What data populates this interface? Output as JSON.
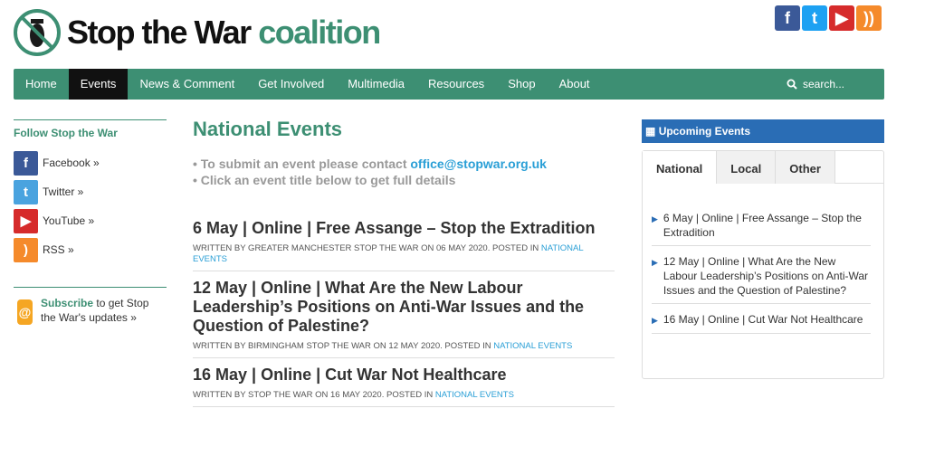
{
  "brand": {
    "name_part1": "Stop the War",
    "name_part2": "coalition"
  },
  "social_top": [
    {
      "icon": "facebook-icon",
      "glyph": "f",
      "color": "#3b5998"
    },
    {
      "icon": "twitter-icon",
      "glyph": "t",
      "color": "#1da1f2"
    },
    {
      "icon": "youtube-icon",
      "glyph": "▶",
      "color": "#d62b2b"
    },
    {
      "icon": "rss-icon",
      "glyph": "))",
      "color": "#f58a2b"
    }
  ],
  "nav": {
    "items": [
      "Home",
      "Events",
      "News & Comment",
      "Get Involved",
      "Multimedia",
      "Resources",
      "Shop",
      "About"
    ],
    "active": "Events",
    "search_placeholder": "search..."
  },
  "follow": {
    "title": "Follow Stop the War",
    "items": [
      {
        "label": "Facebook »",
        "icon": "facebook-icon",
        "color": "#3b5998",
        "glyph": "f"
      },
      {
        "label": "Twitter »",
        "icon": "twitter-icon",
        "color": "#4aa3df",
        "glyph": "t"
      },
      {
        "label": "YouTube »",
        "icon": "youtube-icon",
        "color": "#d62b2b",
        "glyph": "▶"
      },
      {
        "label": "RSS »",
        "icon": "rss-icon",
        "color": "#f58a2b",
        "glyph": ")"
      }
    ],
    "subscribe_bold": "Subscribe",
    "subscribe_rest": " to get Stop the War's updates »"
  },
  "main": {
    "title": "National Events",
    "intro_line1_prefix": "• To submit an event please contact ",
    "intro_email": "office@stopwar.org.uk",
    "intro_line2": "• Click an event title below to get full details",
    "events": [
      {
        "title": "6 May | Online | Free Assange – Stop the Extradition",
        "meta": "Written by Greater Manchester Stop the War on 06 May 2020. Posted in ",
        "category": "National Events"
      },
      {
        "title": "12 May | Online | What Are the New Labour Leadership’s Positions on Anti-War Issues and the Question of Palestine?",
        "meta": "Written by Birmingham Stop the War on 12 May 2020. Posted in ",
        "category": "National Events"
      },
      {
        "title": "16 May | Online | Cut War Not Healthcare",
        "meta": "Written by Stop the War on 16 May 2020. Posted in ",
        "category": "National Events"
      }
    ]
  },
  "sidebar": {
    "upcoming_title": "Upcoming Events",
    "tabs": [
      "National",
      "Local",
      "Other"
    ],
    "active_tab": "National",
    "items": [
      "6 May | Online | Free Assange – Stop the Extradition",
      "12 May | Online | What Are the New Labour Leadership’s Positions on Anti-War Issues and the Question of Palestine?",
      "16 May | Online | Cut War Not Healthcare"
    ]
  },
  "colors": {
    "brand_green": "#3d8f73",
    "link_blue": "#2a9fd6",
    "upcoming_blue": "#2a6db5"
  }
}
